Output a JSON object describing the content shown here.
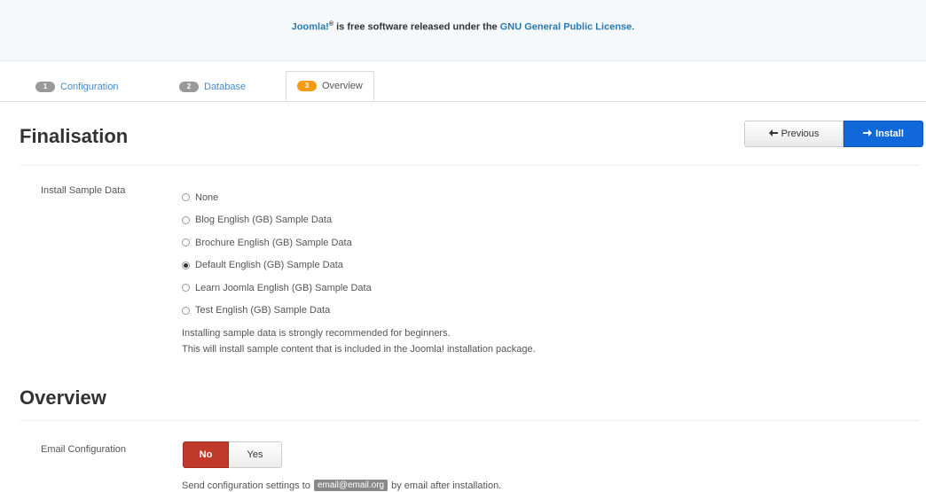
{
  "banner": {
    "product": "Joomla!",
    "reg": "®",
    "text_mid": " is free software released under the ",
    "license_link": "GNU General Public License.",
    "colors": {
      "link": "#2a7ab0",
      "background": "#f6f9fc"
    }
  },
  "tabs": [
    {
      "number": "1",
      "label": "Configuration",
      "active": false
    },
    {
      "number": "2",
      "label": "Database",
      "active": false
    },
    {
      "number": "3",
      "label": "Overview",
      "active": true
    }
  ],
  "finalisation": {
    "title": "Finalisation",
    "previous_label": "Previous",
    "install_label": "Install",
    "previous_icon": "arrow-left-icon",
    "install_icon": "arrow-right-icon"
  },
  "sample_data": {
    "label": "Install Sample Data",
    "options": [
      {
        "label": "None",
        "checked": false
      },
      {
        "label": "Blog English (GB) Sample Data",
        "checked": false
      },
      {
        "label": "Brochure English (GB) Sample Data",
        "checked": false
      },
      {
        "label": "Default English (GB) Sample Data",
        "checked": true
      },
      {
        "label": "Learn Joomla English (GB) Sample Data",
        "checked": false
      },
      {
        "label": "Test English (GB) Sample Data",
        "checked": false
      }
    ],
    "help_line1": "Installing sample data is strongly recommended for beginners.",
    "help_line2": "This will install sample content that is included in the Joomla! installation package."
  },
  "overview": {
    "title": "Overview",
    "email_label": "Email Configuration",
    "no_label": "No",
    "yes_label": "Yes",
    "send_prefix": "Send configuration settings to",
    "email": "email@email.org",
    "send_suffix": "by email after installation."
  },
  "colors": {
    "install_button": "#1168d8",
    "no_toggle": "#c0392b",
    "active_badge": "#f39c12"
  }
}
